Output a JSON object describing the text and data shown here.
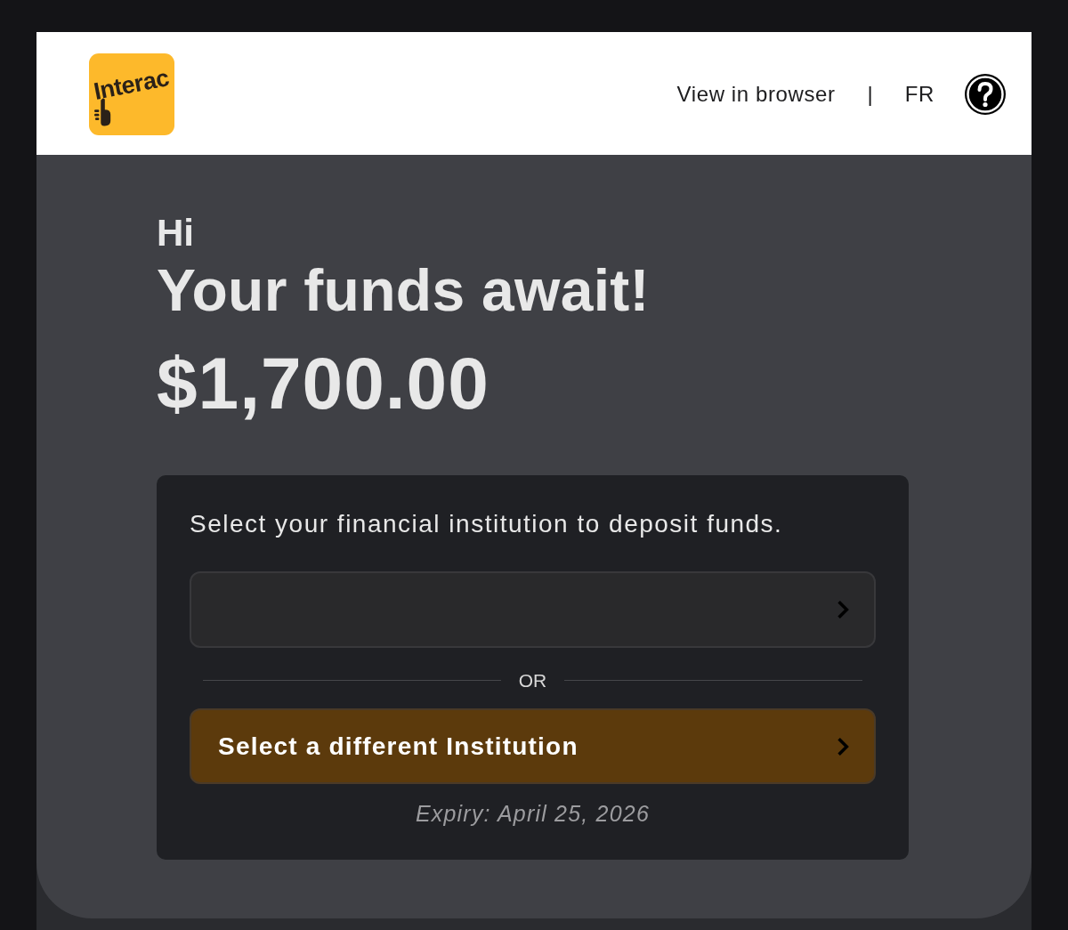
{
  "header": {
    "logo": {
      "text": "Interac"
    },
    "view_link": "View in browser",
    "separator": "|",
    "language": "FR"
  },
  "greeting": "Hi",
  "headline": "Your funds await!",
  "amount": "$1,700.00",
  "card": {
    "instruction": "Select your financial institution to deposit funds.",
    "divider_label": "OR",
    "button": {
      "label": "Select a different Institution"
    },
    "expiry": "Expiry: April 25, 2026"
  }
}
